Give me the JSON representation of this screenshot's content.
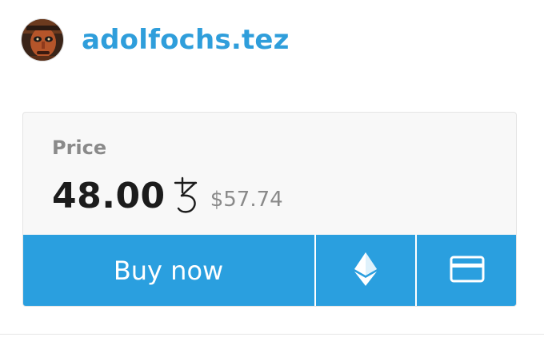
{
  "creator": {
    "name": "adolfochs.tez",
    "avatar_icon": "creator-avatar"
  },
  "price": {
    "label": "Price",
    "value": "48.00",
    "currency_icon": "tezos-icon",
    "fiat": "$57.74"
  },
  "actions": {
    "buy_label": "Buy now",
    "eth_icon": "ethereum-icon",
    "card_icon": "credit-card-icon"
  },
  "colors": {
    "accent": "#2a9fdf",
    "link": "#2f9edb",
    "muted": "#8a8a8a",
    "text": "#1c1c1c"
  }
}
